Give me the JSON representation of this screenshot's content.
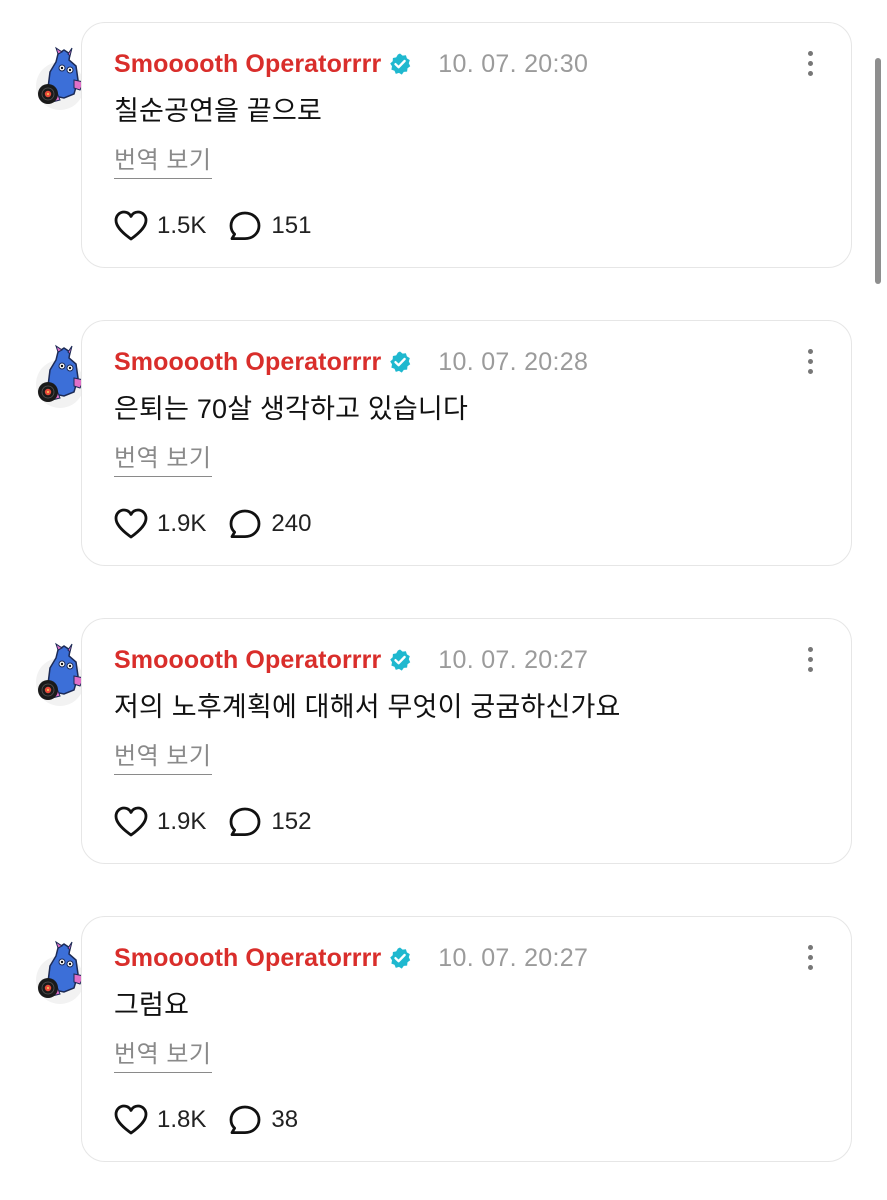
{
  "posts": [
    {
      "author": "Smooooth Operatorrrr",
      "timestamp": "10. 07. 20:30",
      "text": "칠순공연을 끝으로",
      "translate_label": "번역 보기",
      "likes": "1.5K",
      "replies": "151"
    },
    {
      "author": "Smooooth Operatorrrr",
      "timestamp": "10. 07. 20:28",
      "text": "은퇴는 70살 생각하고 있습니다",
      "translate_label": "번역 보기",
      "likes": "1.9K",
      "replies": "240"
    },
    {
      "author": "Smooooth Operatorrrr",
      "timestamp": "10. 07. 20:27",
      "text": "저의 노후계획에 대해서 무엇이 궁굼하신가요",
      "translate_label": "번역 보기",
      "likes": "1.9K",
      "replies": "152"
    },
    {
      "author": "Smooooth Operatorrrr",
      "timestamp": "10. 07. 20:27",
      "text": "그럼요",
      "translate_label": "번역 보기",
      "likes": "1.8K",
      "replies": "38"
    }
  ],
  "icons": {
    "verified": "verified-badge-icon",
    "more": "more-options-icon",
    "like": "heart-icon",
    "reply": "speech-bubble-icon",
    "avatar": "mascot-avatar"
  },
  "colors": {
    "author": "#d92e2b",
    "verified": "#1fb8cf",
    "timestamp": "#9b9b9b",
    "card_border": "#e6e6e6",
    "translate_link": "#8a8a8a"
  }
}
